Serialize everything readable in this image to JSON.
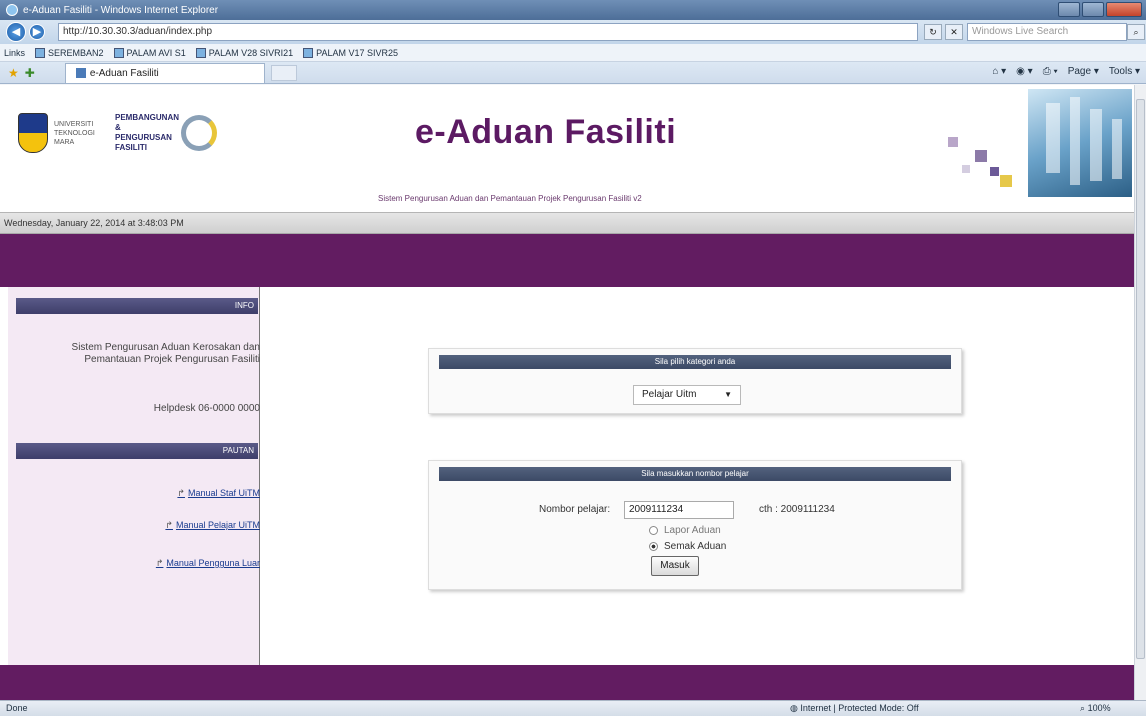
{
  "browser": {
    "window_title": "e-Aduan Fasiliti - Windows Internet Explorer",
    "url": "http://10.30.30.3/aduan/index.php",
    "search_placeholder": "Windows Live Search",
    "links_label": "Links",
    "favorites": [
      "SEREMBAN2",
      "PALAM AVI S1",
      "PALAM V28 SIVRI21",
      "PALAM V17 SIVR25"
    ],
    "tab_title": "e-Aduan Fasiliti",
    "commands": [
      "Page ▾",
      "Tools ▾"
    ],
    "status_left": "Done",
    "status_zone": "Internet | Protected Mode: Off",
    "status_zoom": "100%"
  },
  "header": {
    "title": "e-Aduan Fasiliti",
    "subtitle": "Sistem  Pengurusan Aduan dan Pemantauan Projek Pengurusan Fasiliti v2",
    "logo_text_left": "UNIVERSITI TEKNOLOGI MARA",
    "logo_text_right": "PEMBANGUNAN & PENGURUSAN FASILITI"
  },
  "datebar": {
    "datetime": "Wednesday, January 22, 2014 at 3:48:03 PM"
  },
  "sidebar": {
    "info_heading": "INFO",
    "info_text": "Sistem Pengurusan Aduan Kerosakan dan Pemantauan Projek Pengurusan Fasiliti",
    "helpdesk": "Helpdesk 06-0000 0000",
    "manual_heading": "PAUTAN",
    "links": [
      "Manual Staf UiTM",
      "Manual Pelajar UiTM",
      "Manual Pengguna Luar"
    ]
  },
  "panel_category": {
    "heading": "Sila pilih kategori anda",
    "selected": "Pelajar Uitm"
  },
  "panel_login": {
    "heading": "Sila masukkan nombor pelajar",
    "field_label": "Nombor pelajar:",
    "field_value": "2009111234",
    "example": "cth : 2009111234",
    "option_report": "Lapor Aduan",
    "option_view": "Semak Aduan",
    "submit_label": "Masuk"
  }
}
